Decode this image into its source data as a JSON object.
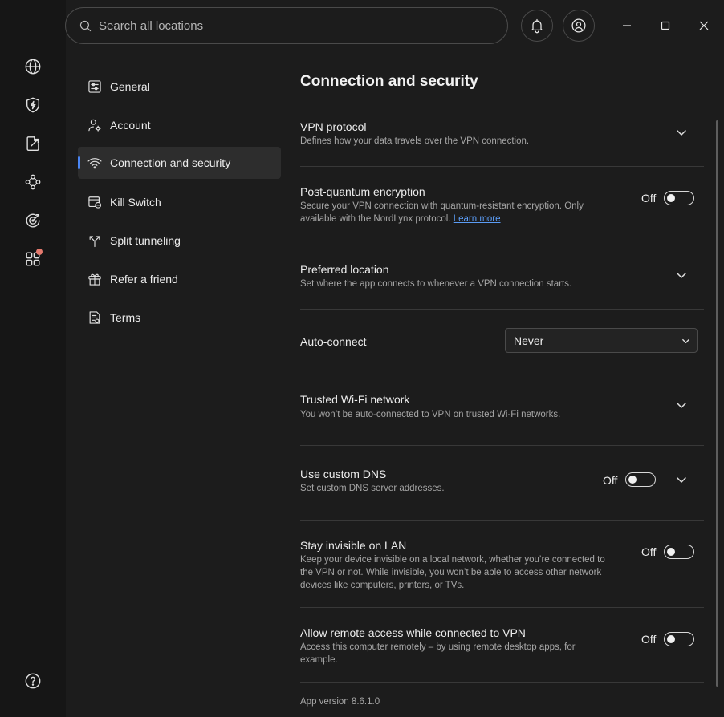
{
  "search": {
    "placeholder": "Search all locations"
  },
  "rail": {
    "items": [
      {
        "icon": "globe-icon"
      },
      {
        "icon": "shield-bolt-icon"
      },
      {
        "icon": "share-export-icon"
      },
      {
        "icon": "meshnet-icon"
      },
      {
        "icon": "target-radar-icon"
      },
      {
        "icon": "apps-grid-icon",
        "badge": true
      },
      {
        "icon": "help-icon"
      }
    ]
  },
  "nav": {
    "items": [
      {
        "label": "General",
        "icon": "sliders-icon"
      },
      {
        "label": "Account",
        "icon": "user-gear-icon"
      },
      {
        "label": "Connection and security",
        "icon": "wifi-icon",
        "active": true
      },
      {
        "label": "Kill Switch",
        "icon": "kill-switch-icon"
      },
      {
        "label": "Split tunneling",
        "icon": "split-arrows-icon"
      },
      {
        "label": "Refer a friend",
        "icon": "gift-icon"
      },
      {
        "label": "Terms",
        "icon": "document-icon"
      }
    ]
  },
  "main": {
    "title": "Connection and security",
    "vpn_protocol": {
      "title": "VPN protocol",
      "desc": "Defines how your data travels over the VPN connection."
    },
    "post_quantum": {
      "title": "Post-quantum encryption",
      "desc": "Secure your VPN connection with quantum-resistant encryption. Only available with the NordLynx protocol.",
      "link": "Learn more",
      "state": "Off"
    },
    "preferred_location": {
      "title": "Preferred location",
      "desc": "Set where the app connects to whenever a VPN connection starts."
    },
    "auto_connect": {
      "title": "Auto-connect",
      "value": "Never"
    },
    "trusted_wifi": {
      "title": "Trusted Wi-Fi network",
      "desc": "You won’t be auto-connected to VPN on trusted Wi-Fi networks."
    },
    "custom_dns": {
      "title": "Use custom DNS",
      "desc": "Set custom DNS server addresses.",
      "state": "Off"
    },
    "invisible_lan": {
      "title": "Stay invisible on LAN",
      "desc": "Keep your device invisible on a local network, whether you’re connected to the VPN or not. While invisible, you won’t be able to access other network devices like computers, printers, or TVs.",
      "state": "Off"
    },
    "remote_access": {
      "title": "Allow remote access while connected to VPN",
      "desc": "Access this computer remotely – by using remote desktop apps, for example.",
      "state": "Off"
    },
    "version": "App version 8.6.1.0"
  },
  "colors": {
    "accent": "#4a86f5",
    "badge": "#e57a6e",
    "link": "#5b9cf5",
    "background": "#1c1c1c"
  }
}
